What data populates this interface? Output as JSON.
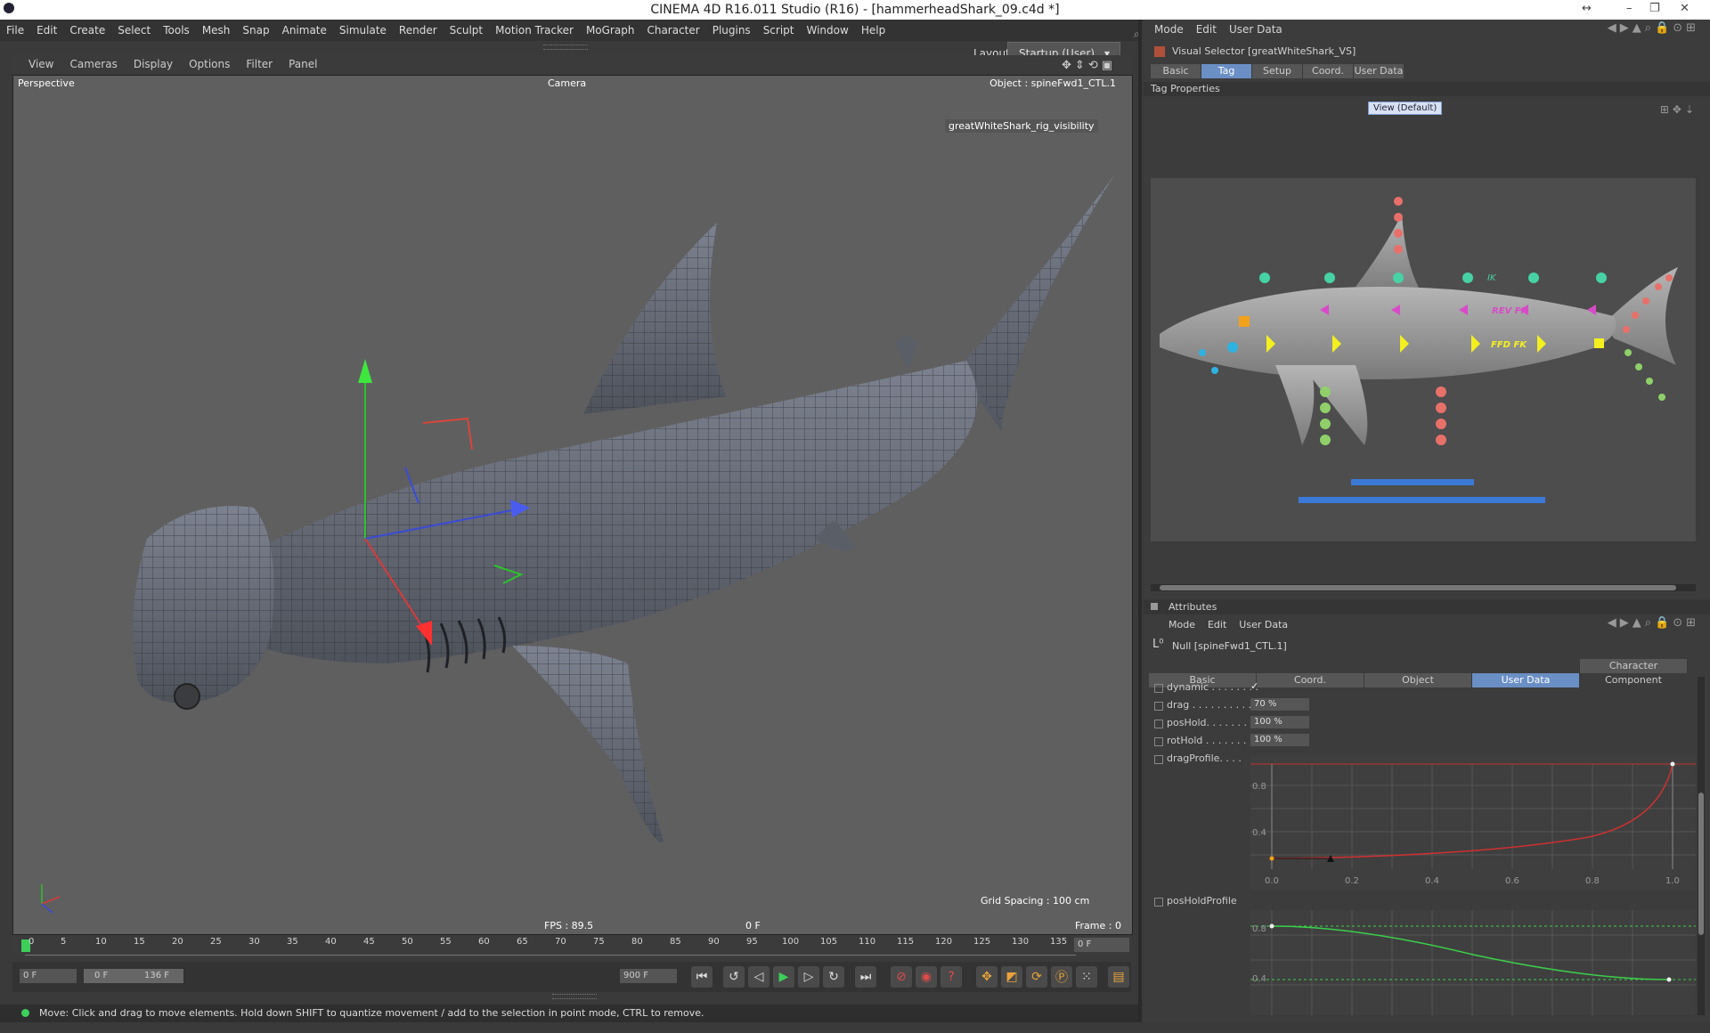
{
  "window": {
    "title": "CINEMA 4D R16.011 Studio (R16) - [hammerheadShark_09.c4d *]"
  },
  "menu": [
    "File",
    "Edit",
    "Create",
    "Select",
    "Tools",
    "Mesh",
    "Snap",
    "Animate",
    "Simulate",
    "Render",
    "Sculpt",
    "Motion Tracker",
    "MoGraph",
    "Character",
    "Plugins",
    "Script",
    "Window",
    "Help"
  ],
  "layout": {
    "label": "Layout:",
    "value": "Startup (User)"
  },
  "viewport": {
    "menu": [
      "View",
      "Cameras",
      "Display",
      "Options",
      "Filter",
      "Panel"
    ],
    "name": "Perspective",
    "camera": "Camera",
    "object": "Object : spineFwd1_CTL.1",
    "tag_label": "greatWhiteShark_rig_visibility",
    "fps": "FPS : 89.5",
    "frame_center": "0 F",
    "grid_spacing": "Grid Spacing : 100 cm",
    "frame": "Frame : 0"
  },
  "timeline": {
    "ticks": [
      "0",
      "5",
      "10",
      "15",
      "20",
      "25",
      "30",
      "35",
      "40",
      "45",
      "50",
      "55",
      "60",
      "65",
      "70",
      "75",
      "80",
      "85",
      "90",
      "95",
      "100",
      "105",
      "110",
      "115",
      "120",
      "125",
      "130",
      "135"
    ],
    "current_frame": "0 F",
    "start_field": "0 F",
    "range_start": "0 F",
    "range_end": "136 F",
    "end_field": "900 F"
  },
  "status": {
    "message": "Move: Click and drag to move elements. Hold down SHIFT to quantize movement / add to the selection in point mode, CTRL to remove."
  },
  "right_top": {
    "menu": [
      "Mode",
      "Edit",
      "User Data"
    ],
    "object_title": "Visual Selector [greatWhiteShark_VS]",
    "tabs": [
      "Basic",
      "Tag",
      "Setup",
      "Coord.",
      "User Data"
    ],
    "active_tab": "Tag",
    "section": "Tag Properties",
    "view_button": "View (Default)",
    "labels": {
      "ik": "IK",
      "rev_fk": "REV FK",
      "ffd_fk": "FFD FK"
    }
  },
  "attributes": {
    "panel_title": "Attributes",
    "menu": [
      "Mode",
      "Edit",
      "User Data"
    ],
    "object_title": "Null [spineFwd1_CTL.1]",
    "tabs": [
      "Basic",
      "Coord.",
      "Object",
      "User Data",
      "Character Component"
    ],
    "active_tab": "User Data",
    "fields": [
      {
        "label": "dynamic . . . . . . . .",
        "value": "✓"
      },
      {
        "label": "drag . . . . . . . . . .",
        "value": "70 %"
      },
      {
        "label": "posHold. . . . . . . .",
        "value": "100 %"
      },
      {
        "label": "rotHold . . . . . . . .",
        "value": "100 %"
      },
      {
        "label": "dragProfile. . . .",
        "value": ""
      }
    ],
    "curve1": {
      "y_ticks": [
        "0.8",
        "0.4"
      ],
      "x_ticks": [
        "0.0",
        "0.2",
        "0.4",
        "0.6",
        "0.8",
        "1.0"
      ]
    },
    "pos_hold_profile": "posHoldProfile",
    "curve2": {
      "y_ticks": [
        "0.8",
        "0.4"
      ]
    }
  }
}
